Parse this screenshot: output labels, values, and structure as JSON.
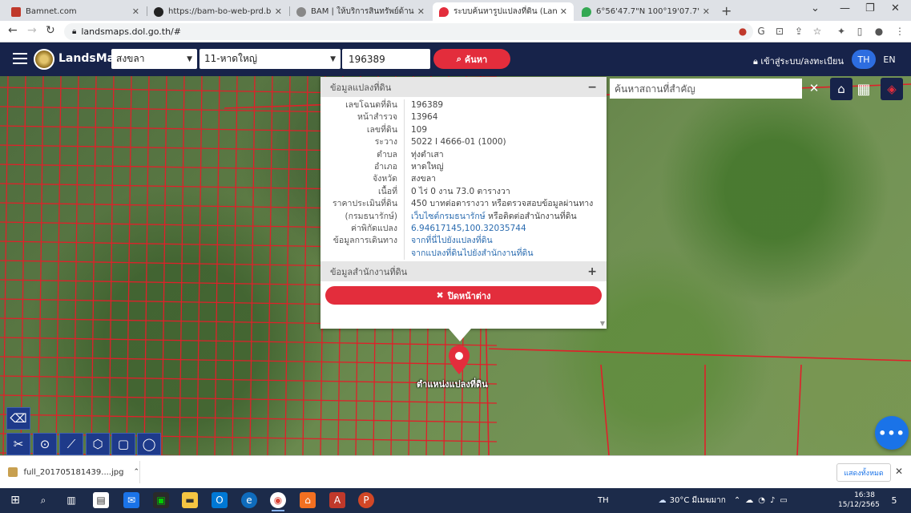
{
  "browser": {
    "tabs": [
      {
        "title": "Bamnet.com",
        "favicon_color": "#c0392b"
      },
      {
        "title": "https://bam-bo-web-prd.bam.co",
        "favicon_color": "#222222"
      },
      {
        "title": "BAM | ให้บริการสินทรัพย์ด้านอสังหาริ",
        "favicon_color": "#666666"
      },
      {
        "title": "ระบบค้นหารูปแปลงที่ดิน (LandsMaps",
        "favicon_color": "#e32d3c"
      },
      {
        "title": "6°56'47.7\"N 100°19'07.7\"E - Goo",
        "favicon_color": "#34a853"
      }
    ],
    "new_tab": "+",
    "url": "landsmaps.dol.go.th/#"
  },
  "app": {
    "brand": "LandsMaps",
    "province_select": "สงขลา",
    "district_select": "11-หาดใหญ่",
    "parcel_number": "196389",
    "search_label": "ค้นหา",
    "login_label": "เข้าสู่ระบบ/ลงทะเบียน",
    "lang_th": "TH",
    "lang_en": "EN"
  },
  "map": {
    "place_search_placeholder": "ค้นหาสถานที่สำคัญ",
    "marker_label": "ตำแหน่งแปลงที่ดิน"
  },
  "popup": {
    "section1_title": "ข้อมูลแปลงที่ดิน",
    "section1_toggle": "−",
    "rows": [
      {
        "key": "เลขโฉนดที่ดิน",
        "value": "196389",
        "link": false
      },
      {
        "key": "หน้าสำรวจ",
        "value": "13964",
        "link": false
      },
      {
        "key": "เลขที่ดิน",
        "value": "109",
        "link": false
      },
      {
        "key": "ระวาง",
        "value": "5022 I 4666-01 (1000)",
        "link": false
      },
      {
        "key": "ตำบล",
        "value": "ทุ่งตำเสา",
        "link": false
      },
      {
        "key": "อำเภอ",
        "value": "หาดใหญ่",
        "link": false
      },
      {
        "key": "จังหวัด",
        "value": "สงขลา",
        "link": false
      },
      {
        "key": "เนื้อที่",
        "value": "0 ไร่ 0 งาน 73.0 ตารางวา",
        "link": false
      },
      {
        "key": "ราคาประเมินที่ดิน",
        "value": "450 บาทต่อตารางวา หรือตรวจสอบข้อมูลผ่านทาง",
        "link": false
      },
      {
        "key": "(กรมธนารักษ์)",
        "value": "เว็บไซต์กรมธนารักษ์",
        "value_suffix": " หรือติดต่อสำนักงานที่ดิน",
        "link": true
      },
      {
        "key": "ค่าพิกัดแปลง",
        "value": "6.94617145,100.32035744",
        "link": true
      },
      {
        "key": "ข้อมูลการเดินทาง",
        "value": "จากที่นี่ไปยังแปลงที่ดิน",
        "link": true
      },
      {
        "key": "",
        "value": "จากแปลงที่ดินไปยังสำนักงานที่ดิน",
        "link": true
      }
    ],
    "section2_title": "ข้อมูลสำนักงานที่ดิน",
    "section2_toggle": "+",
    "close_label": "ปิดหน้าต่าง"
  },
  "downloads": {
    "file_name": "full_201705181439....jpg",
    "show_all": "แสดงทั้งหมด"
  },
  "taskbar": {
    "lang": "TH",
    "weather": "30°C มีเมฆมาก",
    "time": "16:38",
    "date": "15/12/2565",
    "notifications": "5"
  },
  "colors": {
    "header": "#17234a",
    "accent_red": "#e32d3c",
    "parcel_line": "#e0202a",
    "lang_active": "#2d6de0"
  }
}
